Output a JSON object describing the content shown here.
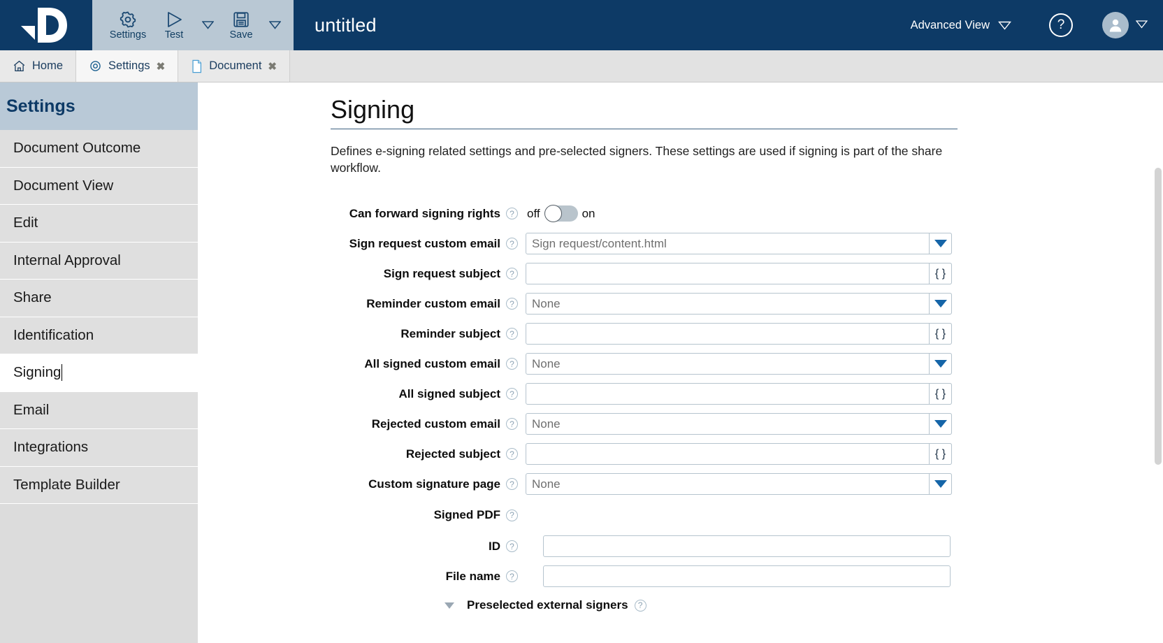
{
  "header": {
    "logo_name": "d4-logo",
    "document_title": "untitled",
    "toolbar": [
      {
        "label": "Settings",
        "icon": "gear-icon",
        "has_caret": false
      },
      {
        "label": "Test",
        "icon": "play-icon",
        "has_caret": true
      },
      {
        "label": "Save",
        "icon": "floppy-disk-icon",
        "has_caret": true
      }
    ],
    "advanced_view_label": "Advanced View",
    "help_label": "?",
    "user_icon": "user-avatar-icon"
  },
  "tabs": [
    {
      "label": "Home",
      "icon": "home-icon",
      "closable": false,
      "active": false
    },
    {
      "label": "Settings",
      "icon": "gear-icon",
      "closable": true,
      "active": true,
      "close_label": "✖"
    },
    {
      "label": "Document",
      "icon": "document-icon",
      "closable": true,
      "active": false,
      "close_label": "✖"
    }
  ],
  "sidebar": {
    "title": "Settings",
    "items": [
      {
        "label": "Document Outcome",
        "selected": false
      },
      {
        "label": "Document View",
        "selected": false
      },
      {
        "label": "Edit",
        "selected": false
      },
      {
        "label": "Internal Approval",
        "selected": false
      },
      {
        "label": "Share",
        "selected": false
      },
      {
        "label": "Identification",
        "selected": false
      },
      {
        "label": "Signing",
        "selected": true
      },
      {
        "label": "Email",
        "selected": false
      },
      {
        "label": "Integrations",
        "selected": false
      },
      {
        "label": "Template Builder",
        "selected": false
      }
    ]
  },
  "main": {
    "title": "Signing",
    "description": "Defines e-signing related settings and pre-selected signers. These settings are used if signing is part of the share workflow.",
    "help_glyph": "?",
    "brace_glyph": "{ }",
    "fields": [
      {
        "label": "Can forward signing rights",
        "type": "toggle",
        "off_label": "off",
        "on_label": "on",
        "value": "off"
      },
      {
        "label": "Sign request custom email",
        "type": "select",
        "value": "Sign request/content.html"
      },
      {
        "label": "Sign request subject",
        "type": "text",
        "value": "",
        "placeholder": ""
      },
      {
        "label": "Reminder custom email",
        "type": "select",
        "value": "None"
      },
      {
        "label": "Reminder subject",
        "type": "text",
        "value": "",
        "placeholder": ""
      },
      {
        "label": "All signed custom email",
        "type": "select",
        "value": "None"
      },
      {
        "label": "All signed subject",
        "type": "text",
        "value": "",
        "placeholder": ""
      },
      {
        "label": "Rejected custom email",
        "type": "select",
        "value": "None"
      },
      {
        "label": "Rejected subject",
        "type": "text",
        "value": "",
        "placeholder": ""
      },
      {
        "label": "Custom signature page",
        "type": "select",
        "value": "None"
      }
    ],
    "signed_pdf": {
      "label": "Signed PDF",
      "sub_fields": [
        {
          "label": "ID",
          "type": "text",
          "value": "",
          "placeholder": ""
        },
        {
          "label": "File name",
          "type": "text",
          "value": "",
          "placeholder": ""
        }
      ]
    },
    "collapsible": {
      "label": "Preselected external signers",
      "expanded": true
    }
  },
  "colors": {
    "brand_navy": "#0d3a66",
    "toolbar_grey": "#b9c8d4",
    "sidebar_grey": "#dcdcdc",
    "sidebar_header": "#b9c9d7",
    "dropdown_arrow_blue": "#1565a8",
    "field_border": "#b6c4ce"
  }
}
